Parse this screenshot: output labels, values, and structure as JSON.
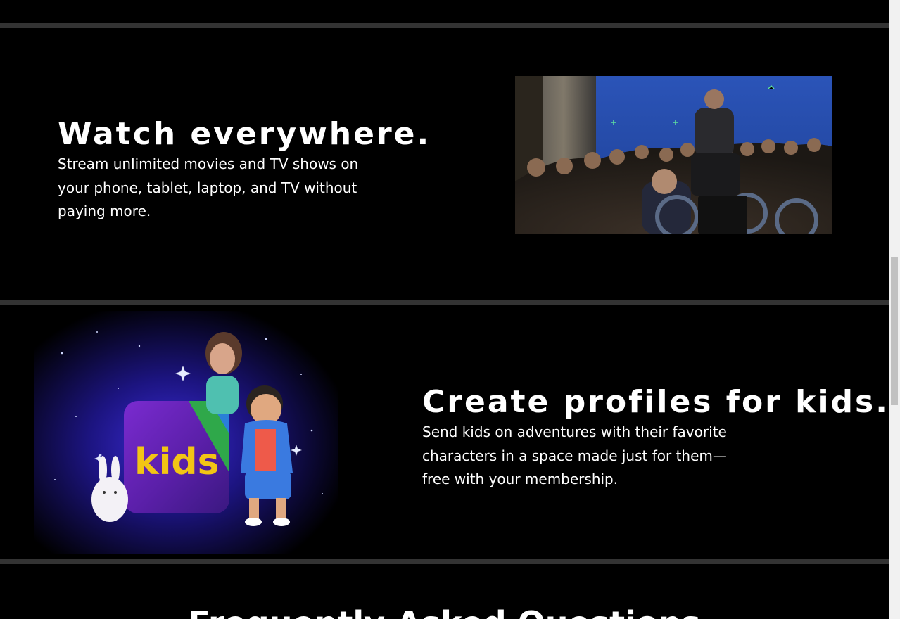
{
  "sections": {
    "watch": {
      "title": "Watch everywhere.",
      "body": "Stream unlimited movies and TV shows on your phone, tablet, laptop, and TV without paying more.",
      "image_alt": "film-set-scene"
    },
    "kids": {
      "title": "Create profiles for kids.",
      "body": "Send kids on adventures with their favorite characters in a space made just for them—free with your membership.",
      "badge_text": "kids",
      "image_alt": "kids-characters-illustration"
    },
    "faq": {
      "title": "Frequently Asked Questions"
    }
  },
  "colors": {
    "background": "#000000",
    "divider": "#333333",
    "text": "#ffffff",
    "scrollbar_track": "#f1f1f1",
    "scrollbar_thumb": "#c1c1c1"
  }
}
